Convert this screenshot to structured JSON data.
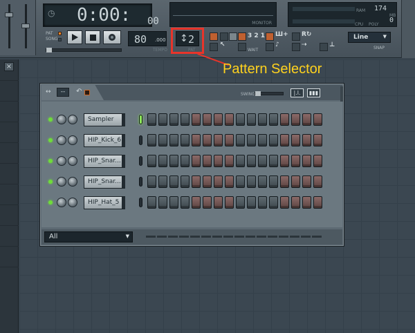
{
  "toolbar": {
    "time": "0:00:",
    "time_sub": "00",
    "monitor_label": "MONITOR",
    "cpu": {
      "value": "174",
      "ram_label": "RAM",
      "cpu_label": "CPU",
      "poly_label": "POLY",
      "mb_label": "MB",
      "zero": "0"
    },
    "pat_label": "PAT",
    "song_label": "SONG",
    "tempo_value": "80",
    "tempo_fraction": ".000",
    "tempo_label": "TEMPO",
    "pattern_value": "2",
    "pattern_label": "PAT",
    "snap_value": "Line",
    "snap_label": "SNAP",
    "wait_label": "WAIT",
    "counter_label": "3 2 1"
  },
  "callout": {
    "text": "Pattern Selector",
    "color": "#ffd21e",
    "highlight_color": "#e8342a"
  },
  "left_strip": {
    "close_glyph": "×"
  },
  "sequencer": {
    "swing_label": "SWING",
    "tab_dash": "--",
    "channels": [
      {
        "name": "Sampler",
        "selected": true
      },
      {
        "name": "HIP_Kick_6",
        "selected": false
      },
      {
        "name": "HIP_Snar...",
        "selected": false
      },
      {
        "name": "HIP_Snar...",
        "selected": false
      },
      {
        "name": "HIP_Hat_5",
        "selected": false
      }
    ],
    "steps_per_row": 16,
    "step_pattern": [
      "dark",
      "dark",
      "dark",
      "dark",
      "red",
      "red",
      "red",
      "red",
      "dark",
      "dark",
      "dark",
      "dark",
      "red",
      "red",
      "red",
      "red"
    ],
    "filter_value": "All"
  }
}
